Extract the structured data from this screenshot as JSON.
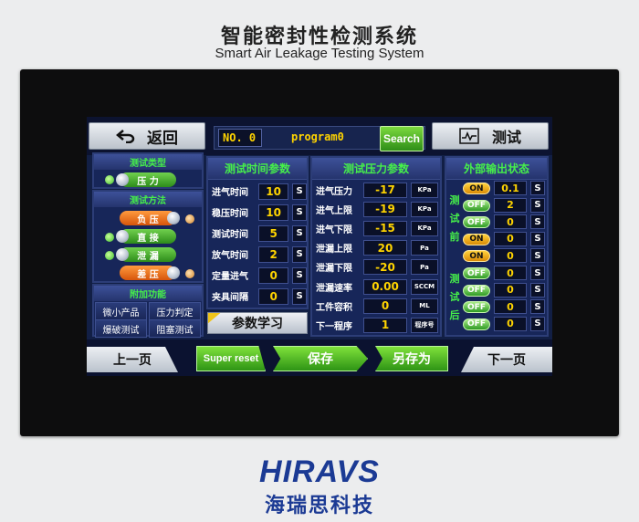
{
  "device": {
    "title": "智能密封性检测系统",
    "subtitle": "Smart Air Leakage Testing System",
    "brand": "HIRAVS",
    "brand_cn": "海瑞思科技"
  },
  "topbar": {
    "back_label": "返回",
    "program_no": "NO. 0",
    "program_name": "program0",
    "search_label": "Search",
    "test_label": "测试"
  },
  "left": {
    "test_type_title": "测试类型",
    "test_type_value": "压 力",
    "method_title": "测试方法",
    "methods": [
      "负 压",
      "直 接",
      "泄 漏",
      "差 压"
    ],
    "extra_title": "附加功能",
    "extra_buttons": [
      "微小产品",
      "压力判定",
      "爆破测试",
      "阻塞测试"
    ]
  },
  "time_params": {
    "title": "测试时间参数",
    "rows": [
      {
        "label": "进气时间",
        "value": "10",
        "unit": "S"
      },
      {
        "label": "稳压时间",
        "value": "10",
        "unit": "S"
      },
      {
        "label": "测试时间",
        "value": "5",
        "unit": "S"
      },
      {
        "label": "放气时间",
        "value": "2",
        "unit": "S"
      },
      {
        "label": "定量进气",
        "value": "0",
        "unit": "S"
      },
      {
        "label": "夹具间隔",
        "value": "0",
        "unit": "S"
      }
    ],
    "learn_label": "参数学习"
  },
  "pressure_params": {
    "title": "测试压力参数",
    "rows": [
      {
        "label": "进气压力",
        "value": "-17",
        "unit": "KPa"
      },
      {
        "label": "进气上限",
        "value": "-19",
        "unit": "KPa"
      },
      {
        "label": "进气下限",
        "value": "-15",
        "unit": "KPa"
      },
      {
        "label": "泄漏上限",
        "value": "20",
        "unit": "Pa"
      },
      {
        "label": "泄漏下限",
        "value": "-20",
        "unit": "Pa"
      },
      {
        "label": "泄漏速率",
        "value": "0.00",
        "unit": "SCCM"
      },
      {
        "label": "工件容积",
        "value": "0",
        "unit": "ML"
      },
      {
        "label": "下一程序",
        "value": "1",
        "unit": "程序号"
      }
    ]
  },
  "output": {
    "title": "外部输出状态",
    "before_label": [
      "测",
      "试",
      "前"
    ],
    "after_label": [
      "测",
      "试",
      "后"
    ],
    "rows": [
      {
        "state": "ON",
        "value": "0.1",
        "unit": "S"
      },
      {
        "state": "OFF",
        "value": "2",
        "unit": "S"
      },
      {
        "state": "OFF",
        "value": "0",
        "unit": "S"
      },
      {
        "state": "ON",
        "value": "0",
        "unit": "S"
      },
      {
        "state": "ON",
        "value": "0",
        "unit": "S"
      },
      {
        "state": "OFF",
        "value": "0",
        "unit": "S"
      },
      {
        "state": "OFF",
        "value": "0",
        "unit": "S"
      },
      {
        "state": "OFF",
        "value": "0",
        "unit": "S"
      },
      {
        "state": "OFF",
        "value": "0",
        "unit": "S"
      }
    ]
  },
  "bottombar": {
    "prev_label": "上一页",
    "super_reset_label": "Super reset",
    "save_label": "保存",
    "save_as_label": "另存为",
    "next_label": "下一页"
  }
}
